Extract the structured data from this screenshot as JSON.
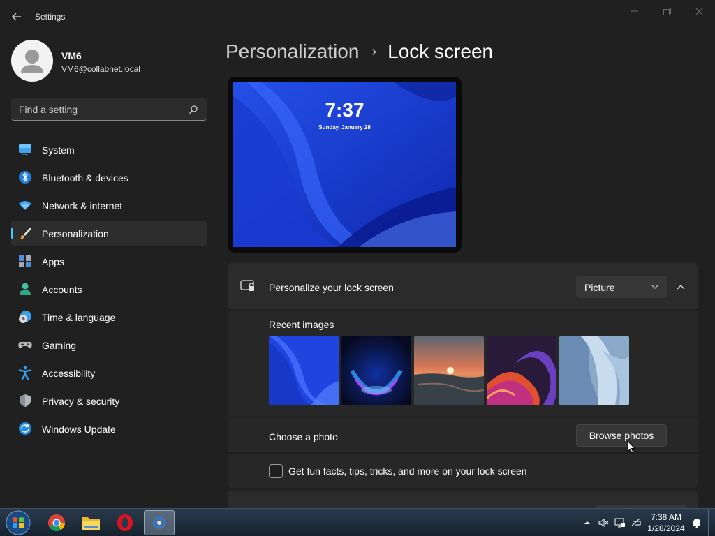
{
  "window": {
    "app_title": "Settings",
    "back_icon": "arrow-left-icon",
    "controls": [
      "minimize-icon",
      "restore-icon",
      "close-icon"
    ]
  },
  "profile": {
    "name": "VM6",
    "email": "VM6@collabnet.local"
  },
  "search": {
    "placeholder": "Find a setting"
  },
  "sidebar": {
    "items": [
      {
        "label": "System",
        "icon": "monitor-icon",
        "active": false
      },
      {
        "label": "Bluetooth & devices",
        "icon": "bluetooth-icon",
        "active": false
      },
      {
        "label": "Network & internet",
        "icon": "wifi-icon",
        "active": false
      },
      {
        "label": "Personalization",
        "icon": "paintbrush-icon",
        "active": true
      },
      {
        "label": "Apps",
        "icon": "apps-icon",
        "active": false
      },
      {
        "label": "Accounts",
        "icon": "person-icon",
        "active": false
      },
      {
        "label": "Time & language",
        "icon": "globe-clock-icon",
        "active": false
      },
      {
        "label": "Gaming",
        "icon": "gamepad-icon",
        "active": false
      },
      {
        "label": "Accessibility",
        "icon": "accessibility-icon",
        "active": false
      },
      {
        "label": "Privacy & security",
        "icon": "shield-icon",
        "active": false
      },
      {
        "label": "Windows Update",
        "icon": "update-icon",
        "active": false
      }
    ]
  },
  "breadcrumb": {
    "parent": "Personalization",
    "separator": "›",
    "current": "Lock screen"
  },
  "preview": {
    "time": "7:37",
    "date": "Sunday, January 28"
  },
  "lock_screen": {
    "personalize_label": "Personalize your lock screen",
    "personalize_value": "Picture",
    "recent_images_label": "Recent images",
    "recent_images": [
      "blue-bloom",
      "blue-purple-glow",
      "sunset-lake",
      "purple-swirl",
      "light-blue-bloom"
    ],
    "choose_photo_label": "Choose a photo",
    "browse_button": "Browse photos",
    "fun_facts_label": "Get fun facts, tips, tricks, and more on your lock screen",
    "fun_facts_checked": false
  },
  "taskbar": {
    "apps": [
      "chrome-icon",
      "file-explorer-icon",
      "opera-icon",
      "settings-icon"
    ],
    "active_app": "settings-icon",
    "tray_icons": [
      "show-hidden-icons-icon",
      "speaker-muted-icon",
      "network-icon",
      "power-icon",
      "notifications-icon"
    ],
    "time": "7:38 AM",
    "date": "1/28/2024"
  },
  "colors": {
    "accent": "#4cc2ff",
    "background": "#202020",
    "card": "#2b2b2b"
  }
}
